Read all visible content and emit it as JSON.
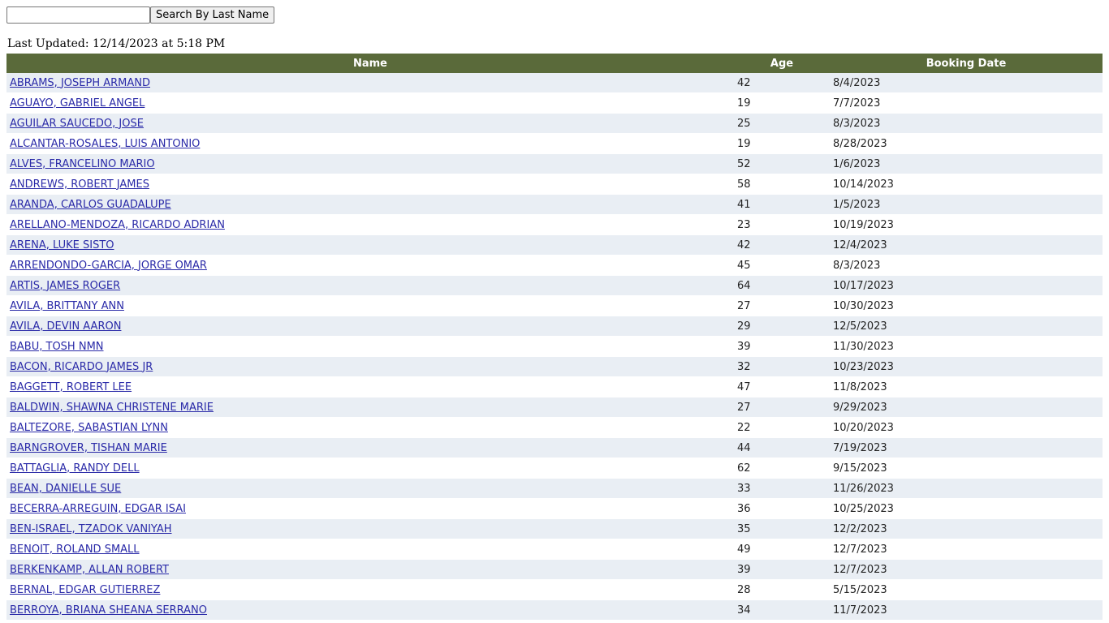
{
  "search": {
    "placeholder": "",
    "value": "",
    "button_label": "Search By Last Name"
  },
  "last_updated": "Last Updated: 12/14/2023 at 5:18 PM",
  "table": {
    "headers": {
      "name": "Name",
      "age": "Age",
      "booking_date": "Booking Date"
    },
    "rows": [
      {
        "name": "ABRAMS, JOSEPH ARMAND",
        "age": "42",
        "booking_date": "8/4/2023"
      },
      {
        "name": "AGUAYO, GABRIEL ANGEL",
        "age": "19",
        "booking_date": "7/7/2023"
      },
      {
        "name": "AGUILAR SAUCEDO, JOSE",
        "age": "25",
        "booking_date": "8/3/2023"
      },
      {
        "name": "ALCANTAR-ROSALES, LUIS ANTONIO",
        "age": "19",
        "booking_date": "8/28/2023"
      },
      {
        "name": "ALVES, FRANCELINO MARIO",
        "age": "52",
        "booking_date": "1/6/2023"
      },
      {
        "name": "ANDREWS, ROBERT JAMES",
        "age": "58",
        "booking_date": "10/14/2023"
      },
      {
        "name": "ARANDA, CARLOS GUADALUPE",
        "age": "41",
        "booking_date": "1/5/2023"
      },
      {
        "name": "ARELLANO-MENDOZA, RICARDO ADRIAN",
        "age": "23",
        "booking_date": "10/19/2023"
      },
      {
        "name": "ARENA, LUKE SISTO",
        "age": "42",
        "booking_date": "12/4/2023"
      },
      {
        "name": "ARRENDONDO-GARCIA, JORGE OMAR",
        "age": "45",
        "booking_date": "8/3/2023"
      },
      {
        "name": "ARTIS, JAMES ROGER",
        "age": "64",
        "booking_date": "10/17/2023"
      },
      {
        "name": "AVILA, BRITTANY ANN",
        "age": "27",
        "booking_date": "10/30/2023"
      },
      {
        "name": "AVILA, DEVIN AARON",
        "age": "29",
        "booking_date": "12/5/2023"
      },
      {
        "name": "BABU, TOSH NMN",
        "age": "39",
        "booking_date": "11/30/2023"
      },
      {
        "name": "BACON, RICARDO JAMES JR",
        "age": "32",
        "booking_date": "10/23/2023"
      },
      {
        "name": "BAGGETT, ROBERT LEE",
        "age": "47",
        "booking_date": "11/8/2023"
      },
      {
        "name": "BALDWIN, SHAWNA CHRISTENE MARIE",
        "age": "27",
        "booking_date": "9/29/2023"
      },
      {
        "name": "BALTEZORE, SABASTIAN LYNN",
        "age": "22",
        "booking_date": "10/20/2023"
      },
      {
        "name": "BARNGROVER, TISHAN MARIE",
        "age": "44",
        "booking_date": "7/19/2023"
      },
      {
        "name": "BATTAGLIA, RANDY DELL",
        "age": "62",
        "booking_date": "9/15/2023"
      },
      {
        "name": "BEAN, DANIELLE SUE",
        "age": "33",
        "booking_date": "11/26/2023"
      },
      {
        "name": "BECERRA-ARREGUIN, EDGAR ISAI",
        "age": "36",
        "booking_date": "10/25/2023"
      },
      {
        "name": "BEN-ISRAEL, TZADOK VANIYAH",
        "age": "35",
        "booking_date": "12/2/2023"
      },
      {
        "name": "BENOIT, ROLAND SMALL",
        "age": "49",
        "booking_date": "12/7/2023"
      },
      {
        "name": "BERKENKAMP, ALLAN ROBERT",
        "age": "39",
        "booking_date": "12/7/2023"
      },
      {
        "name": "BERNAL, EDGAR GUTIERREZ",
        "age": "28",
        "booking_date": "5/15/2023"
      },
      {
        "name": "BERROYA, BRIANA SHEANA SERRANO",
        "age": "34",
        "booking_date": "11/7/2023"
      }
    ]
  },
  "colors": {
    "header_bg": "#5a6a3a",
    "row_alt_bg": "#e9eef4",
    "link": "#2a2aa8"
  }
}
